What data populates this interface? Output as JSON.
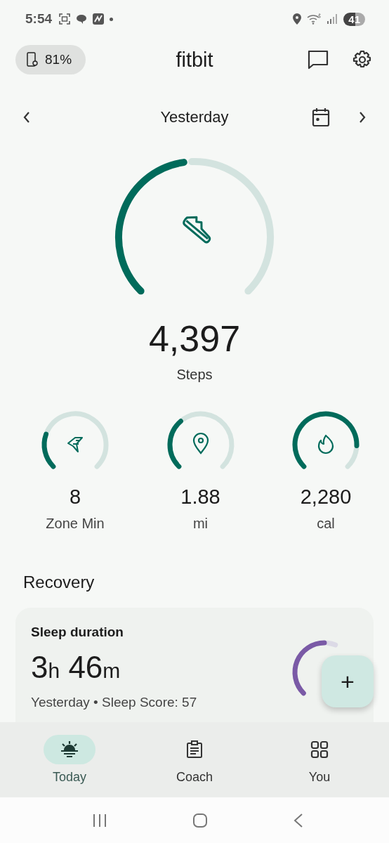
{
  "status_bar": {
    "time": "5:54",
    "battery": "41"
  },
  "header": {
    "device_battery": "81%",
    "logo": "fitbit"
  },
  "date_nav": {
    "label": "Yesterday"
  },
  "steps": {
    "value": "4,397",
    "label": "Steps"
  },
  "stats": [
    {
      "kind": "zone",
      "value": "8",
      "label": "Zone Min"
    },
    {
      "kind": "distance",
      "value": "1.88",
      "label": "mi"
    },
    {
      "kind": "calories",
      "value": "2,280",
      "label": "cal"
    }
  ],
  "section_title": "Recovery",
  "sleep_card": {
    "title": "Sleep duration",
    "hours": "3",
    "hours_unit": "h",
    "minutes": "46",
    "minutes_unit": "m",
    "subtitle": "Yesterday • Sleep Score: 57"
  },
  "fab": {
    "label": "+"
  },
  "tabs": [
    {
      "kind": "today",
      "label": "Today",
      "selected": true
    },
    {
      "kind": "coach",
      "label": "Coach",
      "selected": false
    },
    {
      "kind": "you",
      "label": "You",
      "selected": false
    }
  ]
}
